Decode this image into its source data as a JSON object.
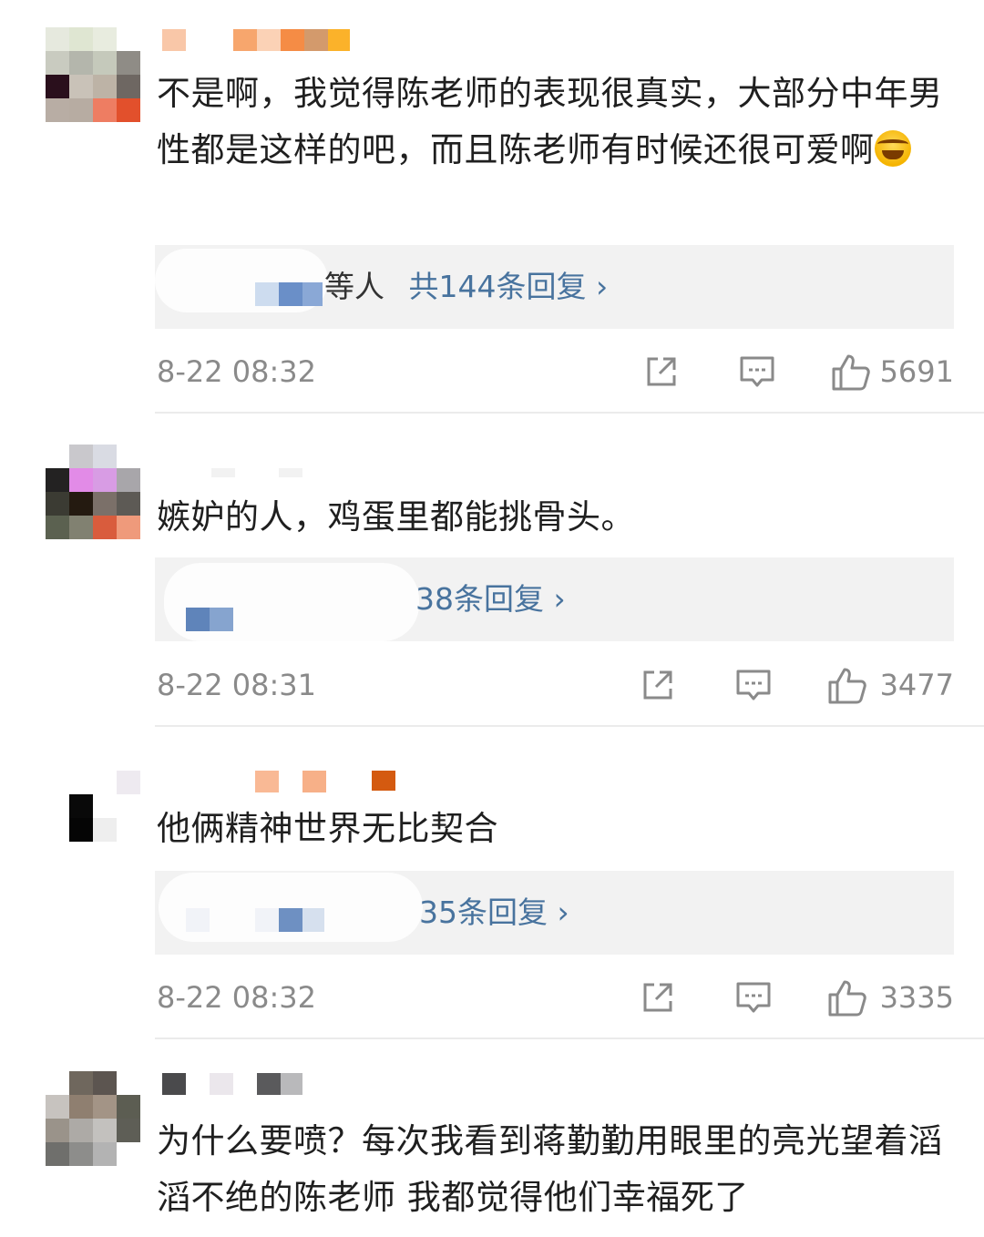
{
  "comments": [
    {
      "text": "不是啊，我觉得陈老师的表现很真实，大部分中年男性都是这样的吧，而且陈老师有时候还很可爱啊",
      "emoji": "grinning-tears-emoji",
      "reply_prefix": "等人",
      "reply_link": "共144条回复 ›",
      "time": "8-22 08:32",
      "likes": "5691"
    },
    {
      "text": "嫉妒的人，鸡蛋里都能挑骨头。",
      "reply_link": "38条回复 ›",
      "time": "8-22 08:31",
      "likes": "3477"
    },
    {
      "text": "他俩精神世界无比契合",
      "reply_link": "35条回复 ›",
      "time": "8-22 08:32",
      "likes": "3335"
    },
    {
      "text": "为什么要喷？每次我看到蒋勤勤用眼里的亮光望着滔滔不绝的陈老师 我都觉得他们幸福死了"
    }
  ],
  "icons": {
    "share": "share-icon",
    "comment": "comment-icon",
    "like": "thumbs-up-icon"
  },
  "colors": {
    "link": "#48739e",
    "text": "#1f1f1f",
    "meta": "#8a8a8a",
    "reply_bg": "#f2f2f2"
  }
}
